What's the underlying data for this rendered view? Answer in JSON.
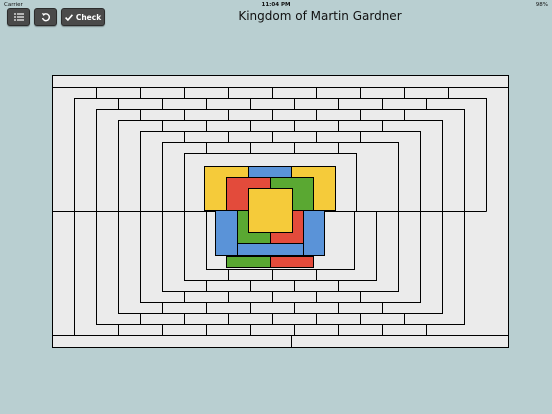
{
  "status": {
    "carrier": "Carrier",
    "time": "11:04 PM",
    "battery": "98%"
  },
  "toolbar": {
    "menu_icon": "list-icon",
    "undo_icon": "undo-icon",
    "check_label": "Check",
    "check_icon": "checkmark-icon"
  },
  "title": "Kingdom of Martin Gardner",
  "colors": {
    "background": "#b9cfd1",
    "board": "#ebebeb",
    "line": "#000000",
    "yellow": "#f5cb3a",
    "blue": "#5a93d8",
    "red": "#e34b3b",
    "green": "#5aa832"
  }
}
